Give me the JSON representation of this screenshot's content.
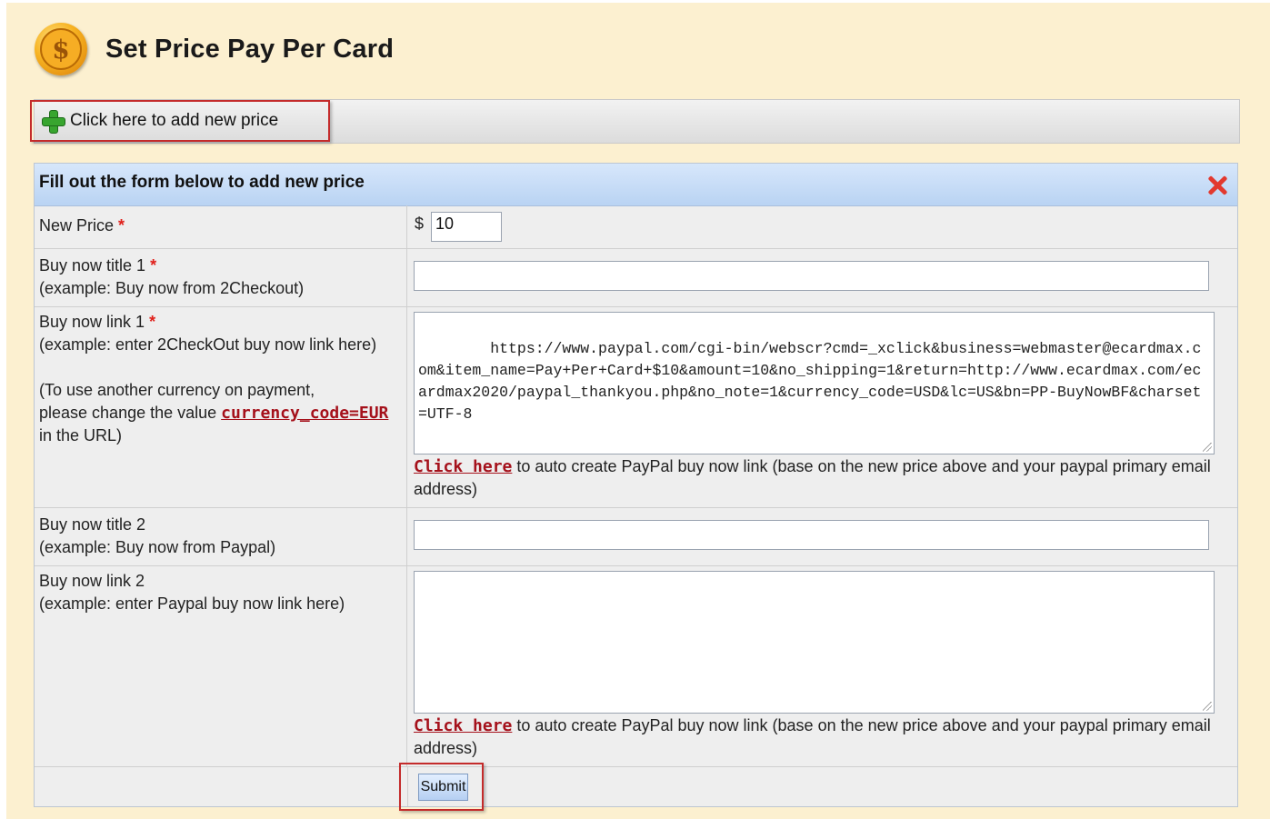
{
  "header": {
    "title": "Set Price Pay Per Card",
    "icon": "dollar-coin-icon"
  },
  "toolbar": {
    "add_label": "Click here to add new price",
    "add_icon": "plus-icon"
  },
  "form": {
    "heading": "Fill out the form below to add new price",
    "close_icon": "close-icon",
    "required_mark": "*",
    "new_price": {
      "label": "New Price",
      "currency": "$",
      "value": "10"
    },
    "title1": {
      "label": "Buy now title 1",
      "example": "(example: Buy now from 2Checkout)",
      "value": ""
    },
    "link1": {
      "label": "Buy now link 1",
      "example": "(example: enter 2CheckOut buy now link here)",
      "note_pre": "(To use another currency on payment,",
      "note_mid": "please change the value ",
      "note_code": "currency_code=EUR",
      "note_post": "in the URL)",
      "value": "https://www.paypal.com/cgi-bin/webscr?cmd=_xclick&business=webmaster@ecardmax.com&item_name=Pay+Per+Card+$10&amount=10&no_shipping=1&return=http://www.ecardmax.com/ecardmax2020/paypal_thankyou.php&no_note=1&currency_code=USD&lc=US&bn=PP-BuyNowBF&charset=UTF-8",
      "help_link": "Click here",
      "help_text": " to auto create PayPal buy now link (base on the new price above and your paypal primary email address)"
    },
    "title2": {
      "label": "Buy now title 2",
      "example": "(example: Buy now from Paypal)",
      "value": ""
    },
    "link2": {
      "label": "Buy now link 2",
      "example": "(example: enter Paypal buy now link here)",
      "value": "",
      "help_link": "Click here",
      "help_text": " to auto create PayPal buy now link (base on the new price above and your paypal primary email address)"
    },
    "submit_label": "Submit"
  },
  "colors": {
    "accent_red": "#c42b2b",
    "link": "#a5111b",
    "header_blue": "#b9d3f3",
    "page_bg": "#fcf0d0"
  }
}
